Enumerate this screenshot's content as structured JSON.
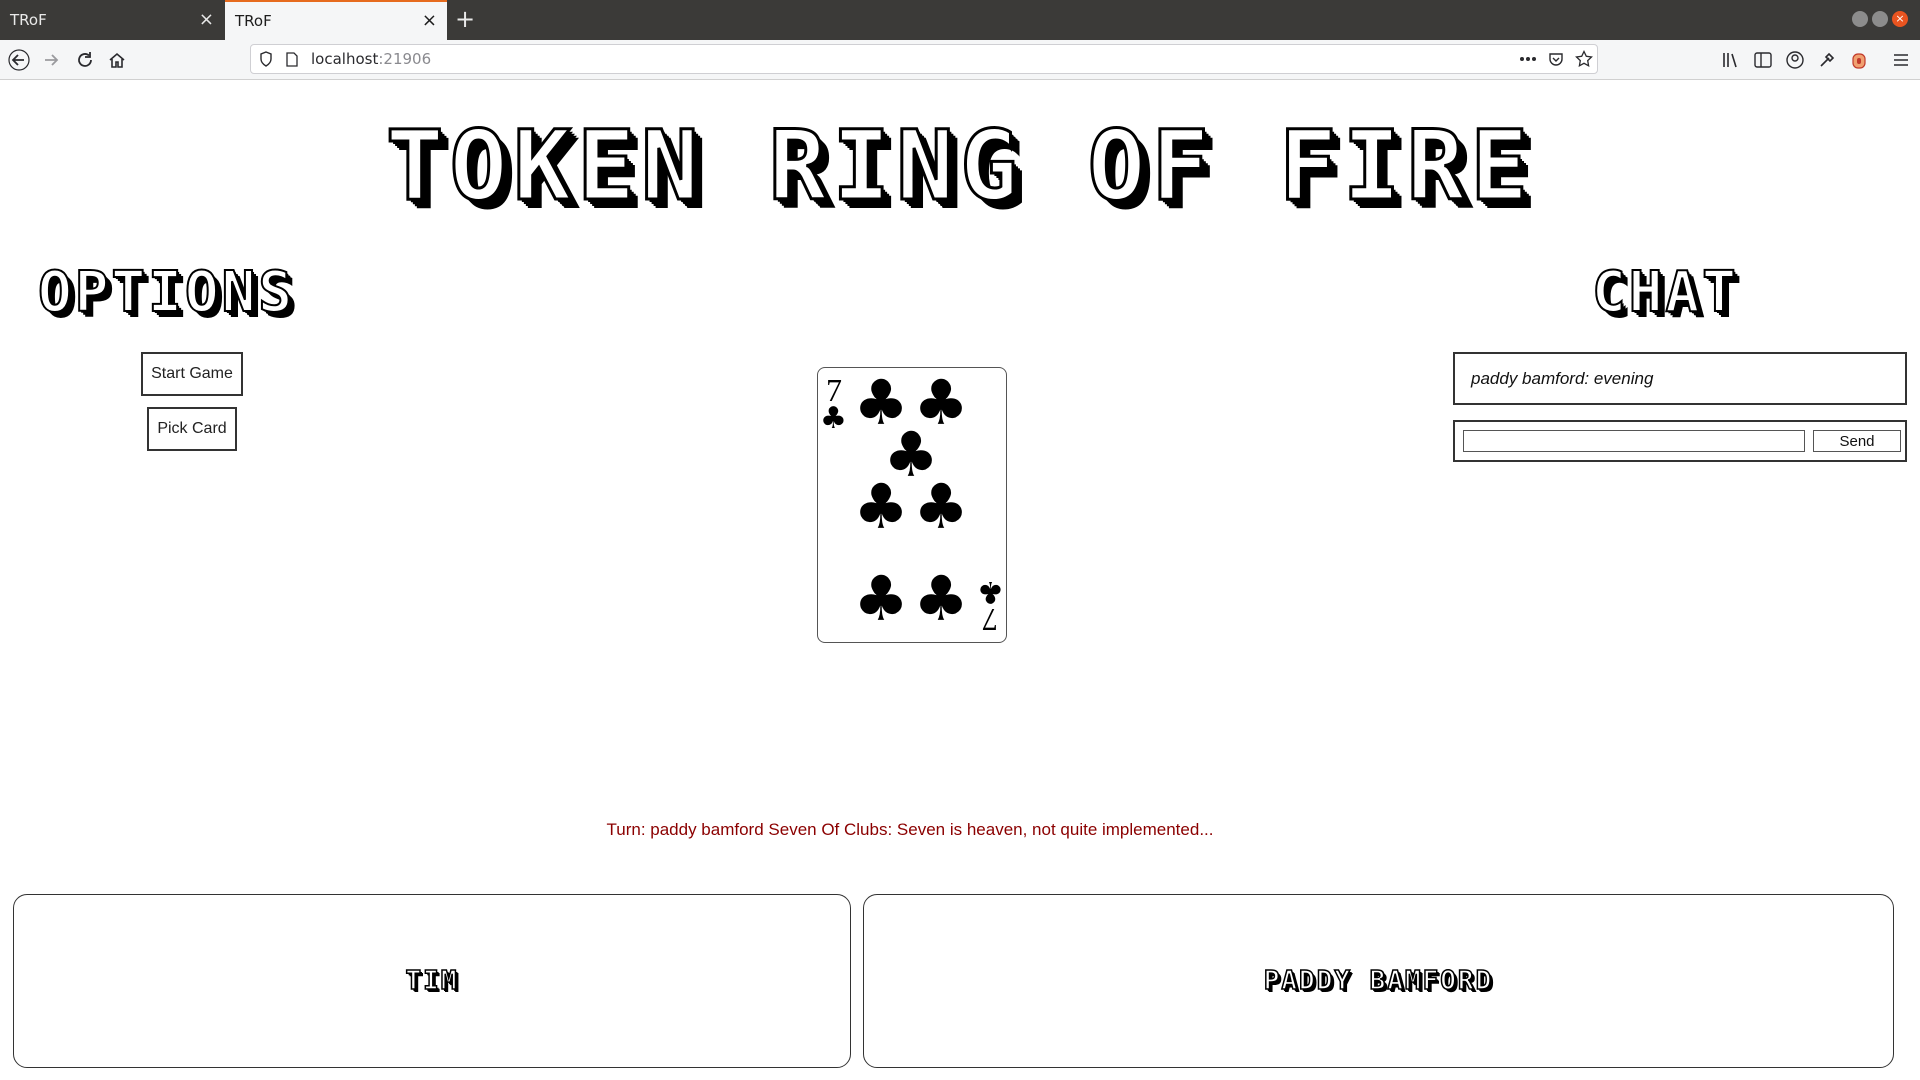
{
  "browser": {
    "tabs": [
      {
        "title": "TRoF",
        "close": "×"
      },
      {
        "title": "TRoF",
        "close": "×"
      }
    ],
    "new_tab": "+",
    "url": {
      "host": "localhost",
      "port": ":21906"
    },
    "icons": [
      "back-icon",
      "forward-icon",
      "reload-icon",
      "home-icon",
      "shield-icon",
      "page-icon",
      "more-icon",
      "pocket-icon",
      "star-icon",
      "library-icon",
      "sidebar-icon",
      "account-icon",
      "eyedropper-icon",
      "extension-icon",
      "menu-icon"
    ]
  },
  "page": {
    "title": "TOKEN RING OF FIRE",
    "options": {
      "heading": "OPTIONS",
      "start_label": "Start Game",
      "pick_label": "Pick Card"
    },
    "card": {
      "rank": "7",
      "suit": "♣",
      "name": "Seven Of Clubs"
    },
    "chat": {
      "heading": "CHAT",
      "messages": [
        "paddy bamford: evening"
      ],
      "input_value": "",
      "send_label": "Send"
    },
    "status": {
      "text": "Turn: paddy bamford Seven Of Clubs: Seven is heaven, not quite implemented...",
      "color": "#8b0000"
    },
    "players": [
      {
        "name": "TIM"
      },
      {
        "name": "PADDY BAMFORD"
      }
    ]
  }
}
